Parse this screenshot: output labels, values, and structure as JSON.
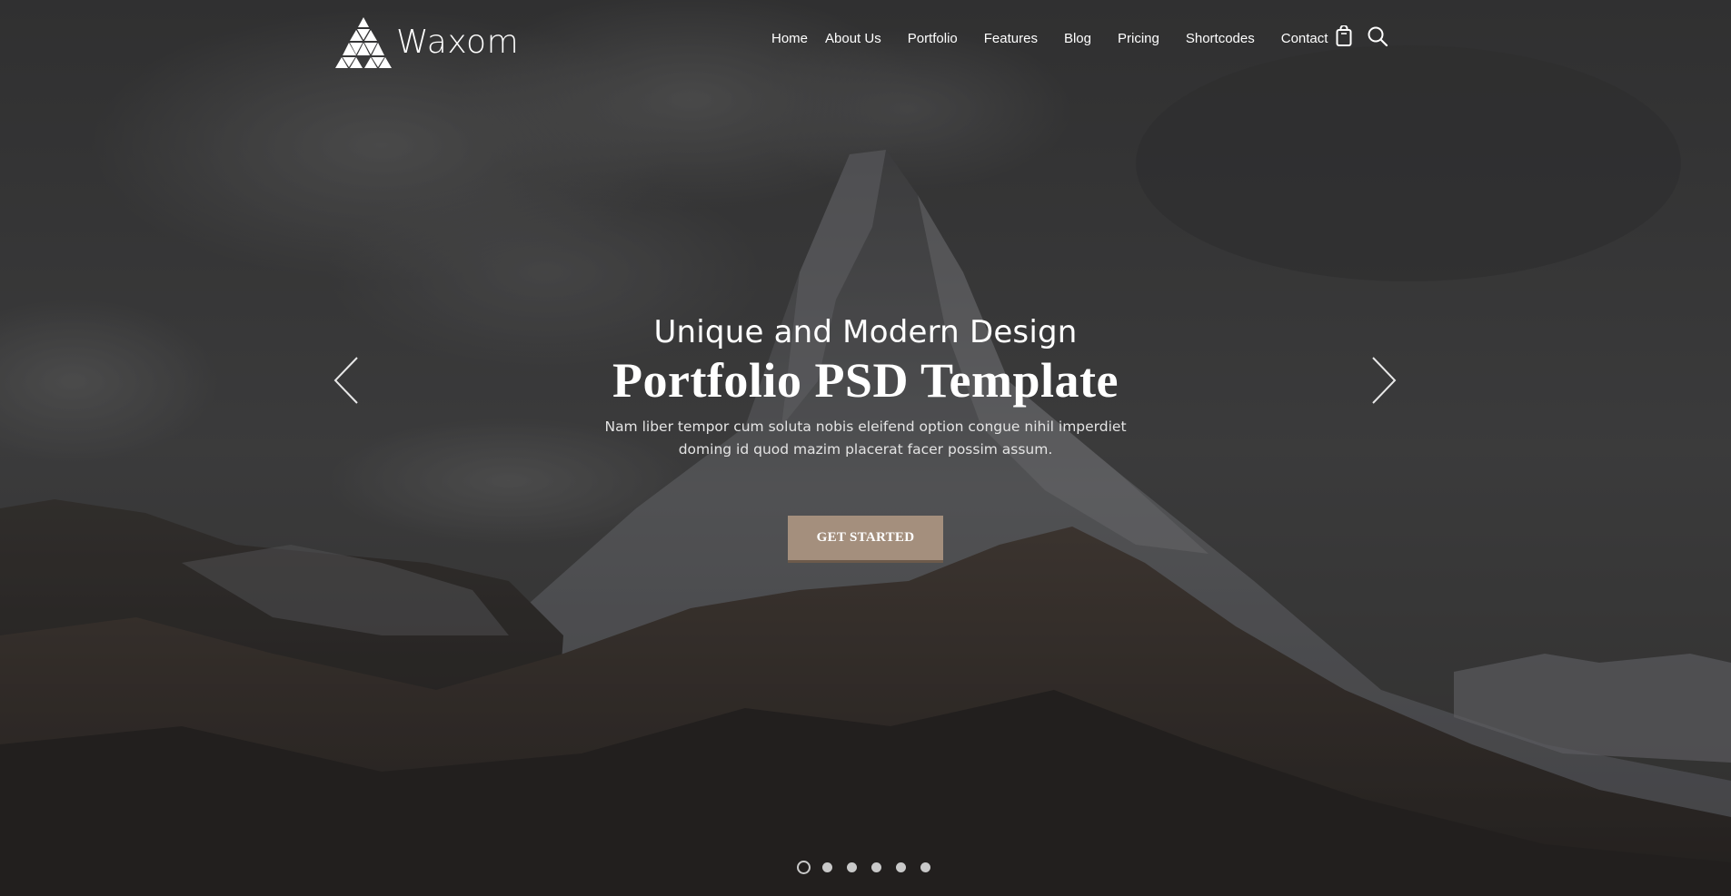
{
  "brand": {
    "name": "Waxom"
  },
  "nav": {
    "items": [
      {
        "label": "Home"
      },
      {
        "label": "About Us"
      },
      {
        "label": "Portfolio"
      },
      {
        "label": "Features"
      },
      {
        "label": "Blog"
      },
      {
        "label": "Pricing"
      },
      {
        "label": "Shortcodes"
      },
      {
        "label": "Contact"
      }
    ],
    "icons": [
      "shopping-bag-icon",
      "search-icon"
    ]
  },
  "slider": {
    "kicker": "Unique and Modern Design",
    "title": "Portfolio PSD Template",
    "description": "Nam liber tempor cum soluta nobis eleifend option congue nihil imperdiet doming id quod mazim placerat facer possim assum.",
    "cta_label": "GET STARTED",
    "slide_count": 6,
    "active_slide": 1
  },
  "colors": {
    "accent": "#a48f7d",
    "accent_shadow": "#6d5a4b",
    "overlay": "#2b2b2c"
  }
}
